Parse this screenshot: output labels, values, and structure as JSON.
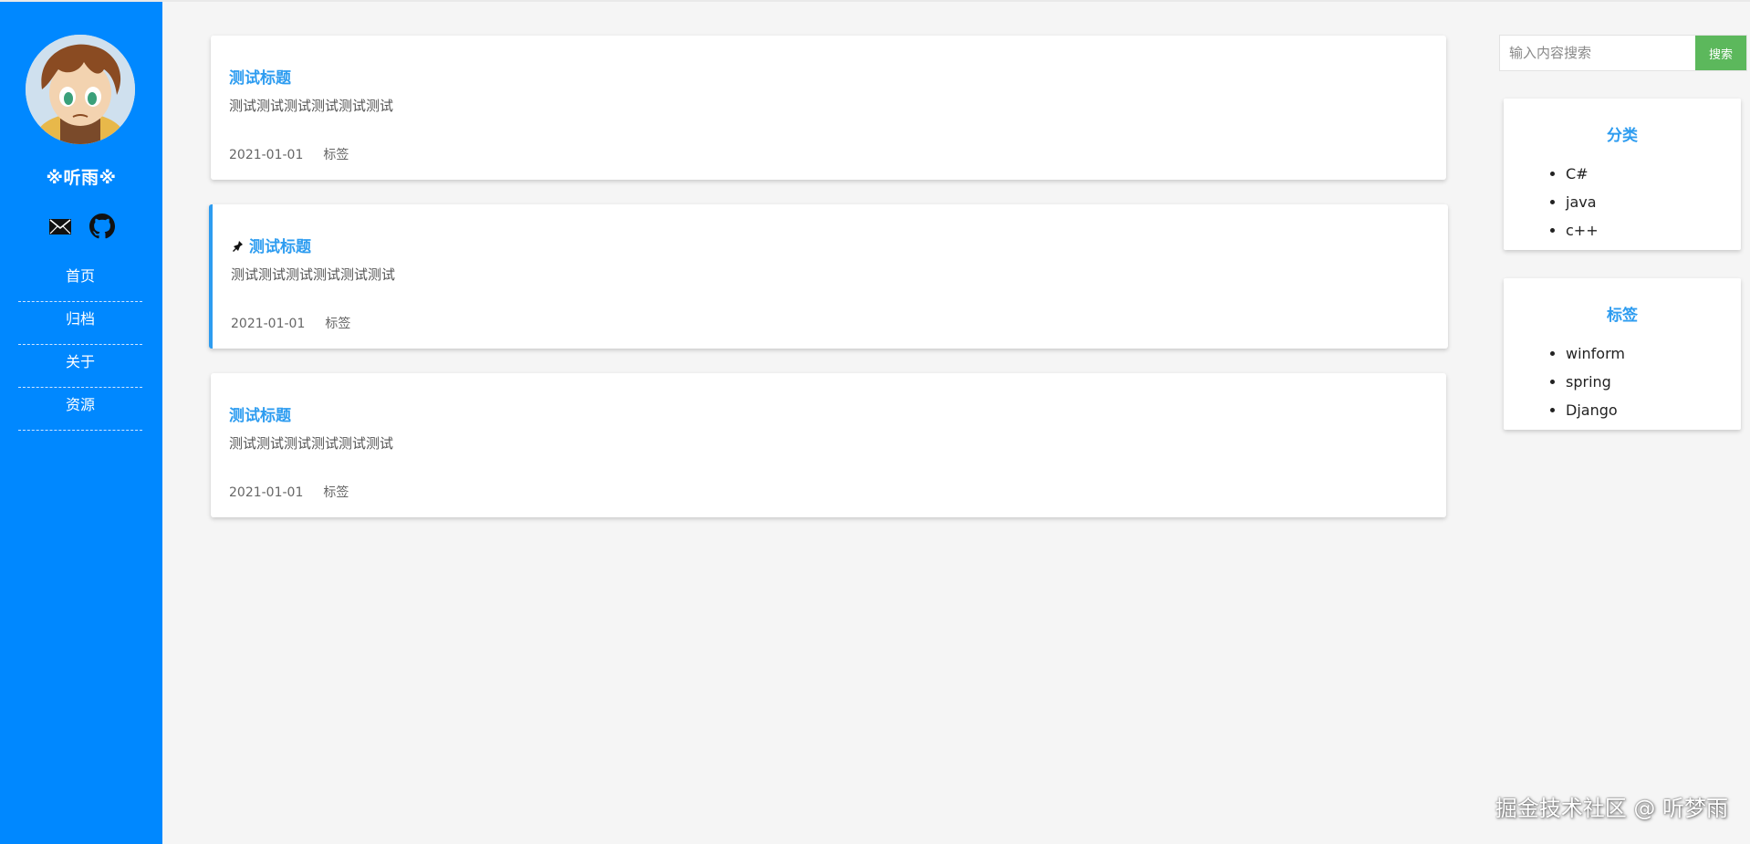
{
  "sidebar": {
    "site_name": "※听雨※",
    "social": [
      {
        "icon": "mail-icon"
      },
      {
        "icon": "github-icon"
      }
    ],
    "nav": [
      {
        "label": "首页"
      },
      {
        "label": "归档"
      },
      {
        "label": "关于"
      },
      {
        "label": "资源"
      }
    ]
  },
  "posts": [
    {
      "title": "测试标题",
      "excerpt": "测试测试测试测试测试测试",
      "date": "2021-01-01",
      "tag": "标签",
      "pinned": false
    },
    {
      "title": "测试标题",
      "excerpt": "测试测试测试测试测试测试",
      "date": "2021-01-01",
      "tag": "标签",
      "pinned": true
    },
    {
      "title": "测试标题",
      "excerpt": "测试测试测试测试测试测试",
      "date": "2021-01-01",
      "tag": "标签",
      "pinned": false
    }
  ],
  "search": {
    "placeholder": "输入内容搜索",
    "button_label": "搜索"
  },
  "categories": {
    "title": "分类",
    "items": [
      "C#",
      "java",
      "c++"
    ]
  },
  "tags": {
    "title": "标签",
    "items": [
      "winform",
      "spring",
      "Django"
    ]
  },
  "watermark": "掘金技术社区 @ 听梦雨",
  "colors": {
    "sidebar": "#0088ff",
    "accent": "#2d9cf0",
    "search_button": "#5cb85c",
    "background": "#f5f5f5"
  }
}
